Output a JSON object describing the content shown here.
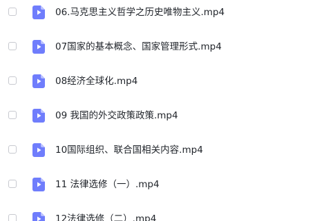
{
  "file_list": {
    "items": [
      {
        "name": "06.马克思主义哲学之历史唯物主义.mp4",
        "icon": "video-file-icon",
        "checked": false
      },
      {
        "name": "07国家的基本概念、国家管理形式.mp4",
        "icon": "video-file-icon",
        "checked": false
      },
      {
        "name": "08经济全球化.mp4",
        "icon": "video-file-icon",
        "checked": false
      },
      {
        "name": "09 我国的外交政策政策.mp4",
        "icon": "video-file-icon",
        "checked": false
      },
      {
        "name": "10国际组织、联合国相关内容.mp4",
        "icon": "video-file-icon",
        "checked": false
      },
      {
        "name": "11 法律选修（一）.mp4",
        "icon": "video-file-icon",
        "checked": false
      },
      {
        "name": "12法律选修（二）.mp4",
        "icon": "video-file-icon",
        "checked": false
      }
    ]
  },
  "colors": {
    "icon_body": "#6f7dfc",
    "icon_fold": "#b9c0ff",
    "icon_play": "#ffffff",
    "text": "#1f2329",
    "checkbox_border": "#c7c9cf"
  }
}
